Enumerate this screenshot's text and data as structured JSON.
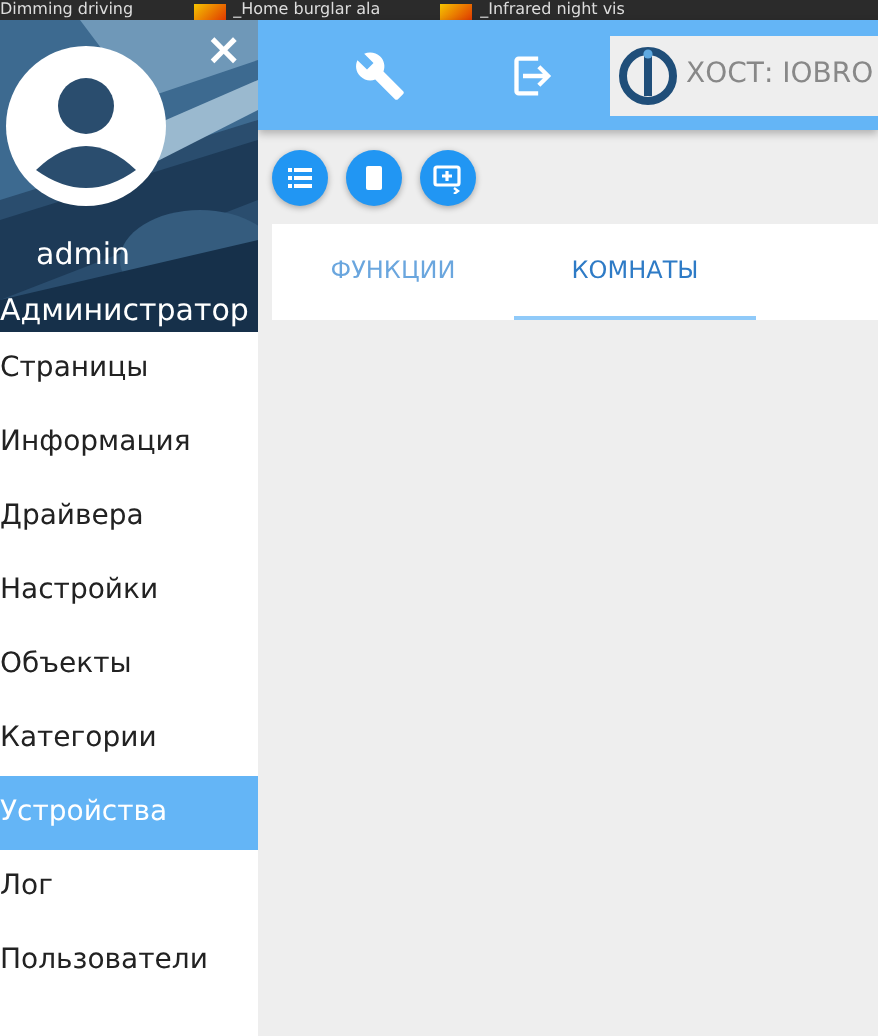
{
  "browser_tabs": [
    {
      "title": "Dimming driving"
    },
    {
      "title": "_Home burglar ala"
    },
    {
      "title": "_Infrared night vis"
    }
  ],
  "sidebar": {
    "user": "admin",
    "role": "Администратор",
    "close": "×",
    "items": [
      {
        "label": "Страницы",
        "selected": false
      },
      {
        "label": "Информация",
        "selected": false
      },
      {
        "label": "Драйвера",
        "selected": false
      },
      {
        "label": "Настройки",
        "selected": false
      },
      {
        "label": "Объекты",
        "selected": false
      },
      {
        "label": "Категории",
        "selected": false
      },
      {
        "label": "Устройства",
        "selected": true
      },
      {
        "label": "Лог",
        "selected": false
      },
      {
        "label": "Пользователи",
        "selected": false
      }
    ]
  },
  "toolbar": {
    "host": "ХОСТ: IOBRO"
  },
  "tabs": [
    {
      "label": "ФУНКЦИИ",
      "selected": false
    },
    {
      "label": "КОМНАТЫ",
      "selected": true
    }
  ]
}
